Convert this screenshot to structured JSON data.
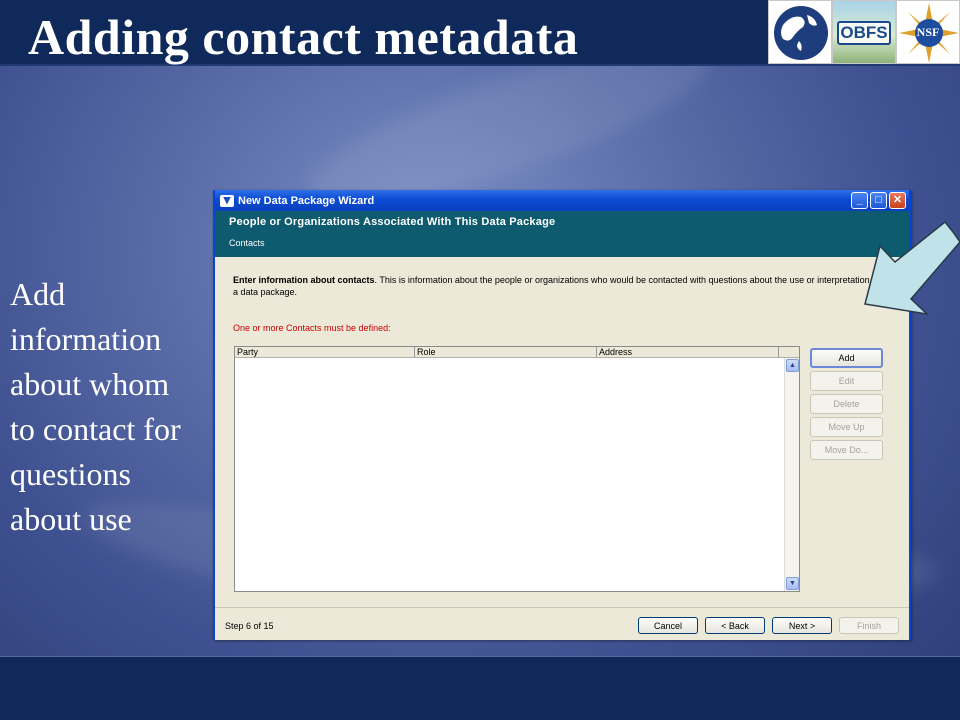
{
  "slide": {
    "title": "Adding contact metadata",
    "body_lines": [
      "Add",
      "information",
      "about whom",
      "to contact for",
      "questions",
      "about use"
    ]
  },
  "logos": {
    "obfs": "OBFS",
    "nsf": "NSF"
  },
  "window": {
    "title": "New Data Package Wizard",
    "controls": {
      "minimize": "_",
      "maximize": "□",
      "close": "✕"
    },
    "header_title": "People or Organizations Associated With This Data Package",
    "header_subtitle": "Contacts",
    "description_bold": "Enter information about contacts",
    "description_rest": ". This is information about the people or organizations who would be contacted with questions about the use or interpretation of a data package.",
    "required_note": "One or more Contacts must be defined:",
    "table": {
      "columns": [
        "Party",
        "Role",
        "Address"
      ],
      "rows": []
    },
    "side_buttons": {
      "add": "Add",
      "edit": "Edit",
      "delete": "Delete",
      "move_up": "Move Up",
      "move_down": "Move Do..."
    },
    "step": "Step 6 of 15",
    "nav": {
      "cancel": "Cancel",
      "back": "< Back",
      "next": "Next >",
      "finish": "Finish"
    }
  },
  "colors": {
    "title_bar": "#0f2a5a",
    "wizard_header": "#0e5a6e",
    "required_text": "#cc0000",
    "callout_arrow": "#bfe3e8"
  }
}
